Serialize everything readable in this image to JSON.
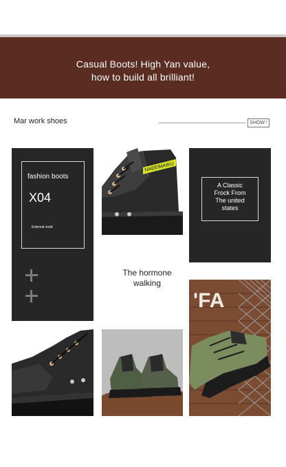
{
  "banner": {
    "line1": "Casual Boots! High Yan value,",
    "line2": "how to build all brilliant!"
  },
  "section": {
    "title": "Mar work shoes",
    "show_button": "SHOW !"
  },
  "left_card": {
    "title": "fashion boots",
    "code": "X04",
    "note": "External mold"
  },
  "right_card": {
    "lines": [
      "A Classic",
      "Frock From",
      "The united",
      "states"
    ]
  },
  "middle_text": {
    "line1": "The hormone",
    "line2": "walking"
  },
  "boot_brand_label": "NAEEIMAIKU",
  "wall_sign_text": "'FA",
  "icons": [
    "plus-icon",
    "plus-icon"
  ]
}
